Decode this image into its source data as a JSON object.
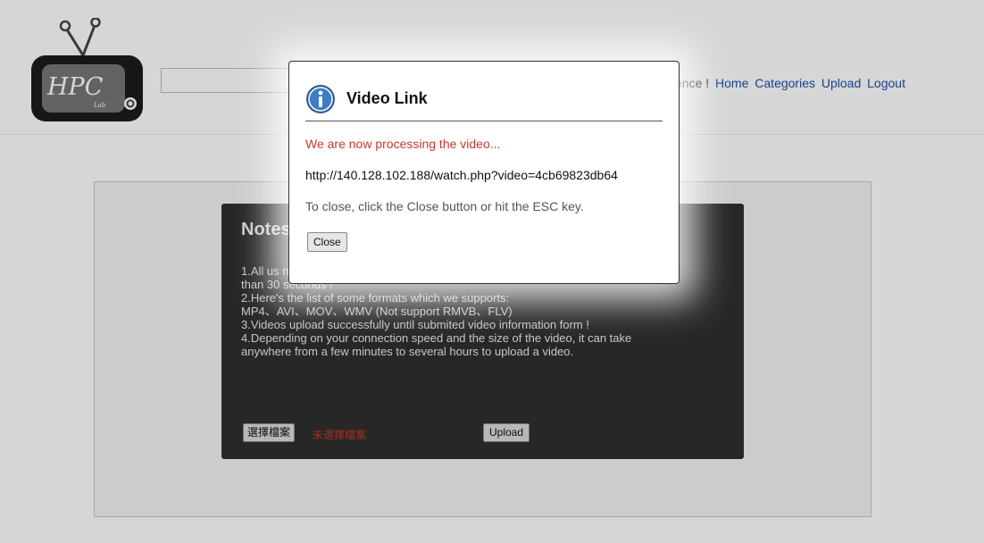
{
  "header": {
    "logo_text": "HPC",
    "logo_sub": "Lab",
    "nav_prefix": "ence !",
    "nav_items": [
      "Home",
      "Categories",
      "Upload",
      "Logout"
    ]
  },
  "notes": {
    "title": "Notes",
    "lines": [
      "1.All us                                                                                              nger",
      "than 30 seconds !",
      "2.Here's the list of some formats which we supports:",
      "MP4、AVI、MOV、WMV (Not support RMVB、FLV)",
      "3.Videos upload successfully until submited video information form !",
      "4.Depending on your connection speed and the size of the video, it can take",
      "anywhere from a few minutes to several hours to upload a video."
    ],
    "file_button": "選擇檔案",
    "file_status": "未選擇檔案",
    "upload_button": "Upload"
  },
  "modal": {
    "title": "Video Link",
    "processing": "We are now processing the video...",
    "link": "http://140.128.102.188/watch.php?video=4cb69823db64",
    "hint": "To close, click the Close button or hit the ESC key.",
    "close_button": "Close"
  },
  "colors": {
    "nav_link": "#1f4fa8",
    "processing_text": "#c9372c",
    "notes_panel": "#2f2f2f"
  }
}
